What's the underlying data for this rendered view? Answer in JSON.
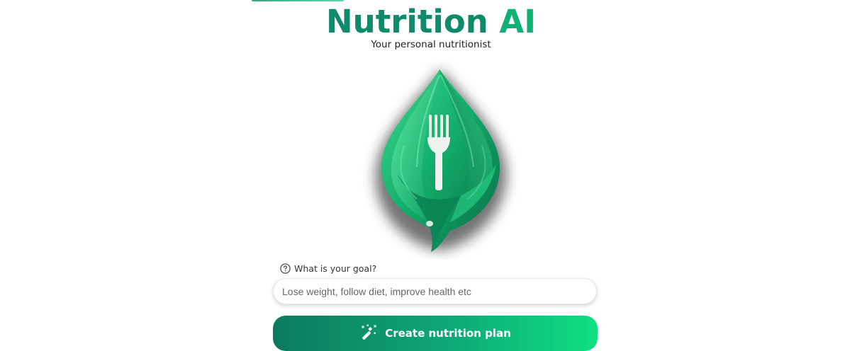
{
  "header": {
    "title_part1": "Nutrition",
    "title_part2": "AI",
    "subtitle": "Your personal nutritionist"
  },
  "logo": {
    "icon": "leaf-fork-logo"
  },
  "goal": {
    "label": "What is your goal?",
    "label_icon": "question-circle-icon",
    "placeholder": "Lose weight, follow diet, improve health etc",
    "value": ""
  },
  "action": {
    "create_label": "Create nutrition plan",
    "icon": "magic-wand-icon"
  },
  "colors": {
    "brand_dark": "#0f8a6a",
    "brand_light": "#11b074",
    "button_start": "#0b7a5e",
    "button_end": "#0ee080"
  }
}
